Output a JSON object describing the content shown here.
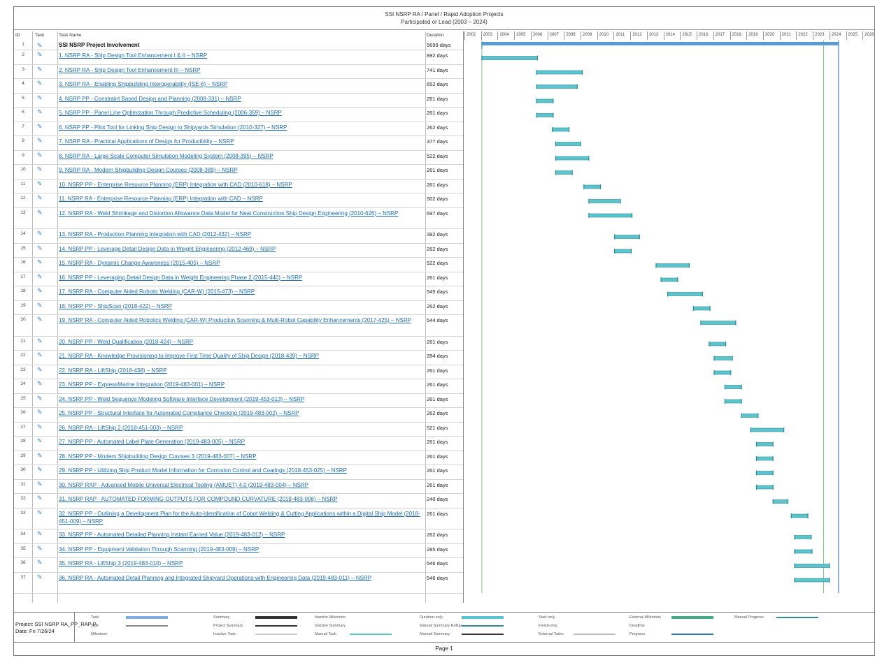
{
  "header": {
    "title": "SSI NSRP RA / Panel / Rapid Adoption Projects",
    "subtitle": "Participated or Lead (2003 – 2024)"
  },
  "columns": {
    "id": "ID",
    "mode": "Task",
    "name": "Task Name",
    "duration": "Duration"
  },
  "years": [
    "2002",
    "2003",
    "2004",
    "2005",
    "2006",
    "2007",
    "2008",
    "2009",
    "2010",
    "2011",
    "2012",
    "2013",
    "2014",
    "2015",
    "2016",
    "2017",
    "2018",
    "2019",
    "2020",
    "2021",
    "2022",
    "2023",
    "2024",
    "2025",
    "2026"
  ],
  "colors": {
    "bar": "#5bc4cc",
    "bar_edge": "#2a8d96",
    "summary": "#5b9bd5",
    "deadline_line": "#7fbf7f",
    "link": "#2e75b6"
  },
  "tasks": [
    {
      "id": "1",
      "name": "SSI NSRP Project Involvement",
      "duration": "5699 days",
      "summary": true,
      "start": 2003.05,
      "end": 2024.55
    },
    {
      "id": "2",
      "name": "1. NSRP RA - Ship Design Tool Enhancement I & II – NSRP",
      "duration": "892 days",
      "start": 2003.05,
      "end": 2006.4
    },
    {
      "id": "3",
      "name": "2. NSRP RA - Ship Design Tool Enhancement III – NSRP",
      "duration": "741 days",
      "start": 2006.35,
      "end": 2009.1
    },
    {
      "id": "4",
      "name": "3. NSRP RA - Enabling Shipbuilding Interoperability (ISE-6) – NSRP",
      "duration": "652 days",
      "start": 2006.35,
      "end": 2008.8
    },
    {
      "id": "5",
      "name": "4. NSRP PP - Constraint Based Design and Planning (2008-331) – NSRP",
      "duration": "261 days",
      "start": 2006.35,
      "end": 2007.35
    },
    {
      "id": "6",
      "name": "5. NSRP PP - Panel Line Optimization Through Predictive Scheduling (2006-359) – NSRP",
      "duration": "261 days",
      "start": 2006.35,
      "end": 2007.35
    },
    {
      "id": "7",
      "name": "6. NSRP PP - Pilot Tool for Linking Ship Design to Shipyards Simulation (2010-327) – NSRP",
      "duration": "262 days",
      "start": 2007.3,
      "end": 2008.3
    },
    {
      "id": "8",
      "name": "7. NSRP RA - Practical Applications of Design for Producibility – NSRP",
      "duration": "377 days",
      "start": 2007.5,
      "end": 2009.0
    },
    {
      "id": "9",
      "name": "8. NSRP RA - Large Scale Computer Simulation Modeling System (2008-395) – NSRP",
      "duration": "522 days",
      "start": 2007.5,
      "end": 2009.5
    },
    {
      "id": "10",
      "name": "9. NSRP RA - Modern Shipbuilding Design Courses (2008-389) – NSRP",
      "duration": "261 days",
      "start": 2007.5,
      "end": 2008.5
    },
    {
      "id": "11",
      "name": "10. NSRP PP - Enterprise Resource Planning (ERP) Integration with CAD (2010-618) – NSRP",
      "duration": "261 days",
      "start": 2009.2,
      "end": 2010.2
    },
    {
      "id": "12",
      "name": "11. NSRP RA - Enterprise Resource Planning (ERP) Integration with CAD – NSRP",
      "duration": "502 days",
      "start": 2009.5,
      "end": 2011.4
    },
    {
      "id": "13",
      "name": "12. NSRP RA - Weld Shrinkage and Distortion Allowance Data Model for Neat Construction Ship Design Engineering (2010-626) – NSRP",
      "duration": "697 days",
      "start": 2009.5,
      "end": 2012.1,
      "tall": true
    },
    {
      "id": "14",
      "name": "13. NSRP RA - Production Planning Integration with CAD (2012-432) – NSRP",
      "duration": "392 days",
      "start": 2011.05,
      "end": 2012.55
    },
    {
      "id": "15",
      "name": "14. NSRP PP - Leverage Detail Design Data in Weight Engineering (2012-469) – NSRP",
      "duration": "262 days",
      "start": 2011.05,
      "end": 2012.05
    },
    {
      "id": "16",
      "name": "15. NSRP RA - Dynamic Change Awareness (2015-405) – NSRP",
      "duration": "522 days",
      "start": 2013.55,
      "end": 2015.55
    },
    {
      "id": "17",
      "name": "16. NSRP PP - Leveraging Detail Design Data in Weight Engineering Phase 2 (2015-440) – NSRP",
      "duration": "261 days",
      "start": 2013.85,
      "end": 2014.85
    },
    {
      "id": "18",
      "name": "17. NSRP RA - Computer Aided Robotic Welding (CAR-W) (2015-473) – NSRP",
      "duration": "545 days",
      "start": 2014.25,
      "end": 2016.35
    },
    {
      "id": "19",
      "name": "18. NSRP PP - ShipScan (2018-422) – NSRP",
      "duration": "262 days",
      "start": 2015.8,
      "end": 2016.8
    },
    {
      "id": "20",
      "name": "19. NSRP RA - Computer Aided Robotics Welding (CAR-W) Production Scanning & Multi-Robot Capability Enhancements (2017-425) – NSRP",
      "duration": "544 days",
      "start": 2016.25,
      "end": 2018.35,
      "tall": true
    },
    {
      "id": "21",
      "name": "20. NSRP PP - Weld Qualification (2018-424) – NSRP",
      "duration": "261 days",
      "start": 2016.75,
      "end": 2017.75
    },
    {
      "id": "22",
      "name": "21. NSRP RA - Knowledge Provisioning to Improve First Time Quality of Ship Design (2018-439) – NSRP",
      "duration": "284 days",
      "start": 2017.05,
      "end": 2018.15
    },
    {
      "id": "23",
      "name": "22. NSRP RA - LiftShip (2018-438) – NSRP",
      "duration": "261 days",
      "start": 2017.05,
      "end": 2018.05
    },
    {
      "id": "24",
      "name": "23. NSRP PP - ExpressMarine Integration (2019-483-001) – NSRP",
      "duration": "261 days",
      "start": 2017.7,
      "end": 2018.7
    },
    {
      "id": "25",
      "name": "24. NSRP PP - Weld Sequence Modeling Software Interface Development (2019-453-013) – NSRP",
      "duration": "261 days",
      "start": 2017.7,
      "end": 2018.7
    },
    {
      "id": "26",
      "name": "25. NSRP PP - Structural Interface for Automated Compliance Checking (2019-483-002) – NSRP",
      "duration": "262 days",
      "start": 2018.7,
      "end": 2019.7
    },
    {
      "id": "27",
      "name": "26. NSRP RA - LiftShip 2 (2018-451-003) – NSRP",
      "duration": "521 days",
      "start": 2019.25,
      "end": 2021.25
    },
    {
      "id": "28",
      "name": "27. NSRP PP - Automated Label Plate Generation (2019-483-005) – NSRP",
      "duration": "261 days",
      "start": 2019.6,
      "end": 2020.6
    },
    {
      "id": "29",
      "name": "28. NSRP PP - Modern Shipbuilding Design Courses 3 (2019-483-007) – NSRP",
      "duration": "261 days",
      "start": 2019.6,
      "end": 2020.6
    },
    {
      "id": "30",
      "name": "29. NSRP PP - Utilizing Ship Product Model Information for Corrosion Control and Coatings (2018-453-025) – NSRP",
      "duration": "261 days",
      "start": 2019.6,
      "end": 2020.6
    },
    {
      "id": "31",
      "name": "30. NSRP RAP - Advanced Mobile Universal Electrical Tooling (AMUET) 4.0 (2019-483-004) – NSRP",
      "duration": "261 days",
      "start": 2019.6,
      "end": 2020.6
    },
    {
      "id": "32",
      "name": "31. NSRP RAP - AUTOMATED FORMING OUTPUTS FOR COMPOUND CURVATURE (2019-483-006) – NSRP",
      "duration": "240 days",
      "start": 2020.6,
      "end": 2021.5
    },
    {
      "id": "33",
      "name": "32. NSRP PP - Outlining a Development Plan for the Auto-Identification of Cobot Welding & Cutting Applications within a Digital Ship Model (2018-451-009) – NSRP",
      "duration": "261 days",
      "start": 2021.7,
      "end": 2022.7,
      "tall": true
    },
    {
      "id": "34",
      "name": "33. NSRP PP - Automated Detailed Planning Instant Earned Value (2019-483-012) – NSRP",
      "duration": "262 days",
      "start": 2021.9,
      "end": 2022.9
    },
    {
      "id": "35",
      "name": "34. NSRP PP - Equipment Validation Through Scanning (2019-483-009) – NSRP",
      "duration": "285 days",
      "start": 2021.9,
      "end": 2022.95
    },
    {
      "id": "36",
      "name": "35. NSRP RA - LiftShip 3 (2019-483-010) – NSRP",
      "duration": "546 days",
      "start": 2021.9,
      "end": 2024.0
    },
    {
      "id": "37",
      "name": "36. NSRP RA - Automated Detail Planning and Integrated Shipyard Operations with Engineering Data (2019-483-011) – NSRP",
      "duration": "546 days",
      "start": 2021.9,
      "end": 2024.0,
      "tall": true
    }
  ],
  "legend": {
    "project": "Project: SSI NSRP RA_PP_RAP P",
    "date": "Date: Fri 7/26/24",
    "items": [
      "Task",
      "Split",
      "Milestone",
      "Summary",
      "Project Summary",
      "Inactive Task",
      "Inactive Milestone",
      "Inactive Summary",
      "Manual Task",
      "Duration-only",
      "Manual Summary Rollup",
      "Manual Summary",
      "Start-only",
      "Finish-only",
      "External Tasks",
      "External Milestone",
      "Deadline",
      "Progress",
      "Manual Progress"
    ]
  },
  "footer": "Page 1"
}
